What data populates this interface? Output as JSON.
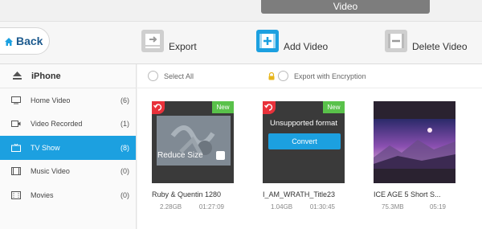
{
  "window": {
    "tab": "Video"
  },
  "toolbar": {
    "back_label": "Back",
    "export_label": "Export",
    "add_label": "Add Video",
    "delete_label": "Delete Video"
  },
  "sidebar": {
    "device": "iPhone",
    "items": [
      {
        "label": "Home Video",
        "count": "(6)",
        "icon": "tv-icon"
      },
      {
        "label": "Video Recorded",
        "count": "(1)",
        "icon": "camera-icon"
      },
      {
        "label": "TV Show",
        "count": "(8)",
        "icon": "tv-show-icon"
      },
      {
        "label": "Music Video",
        "count": "(0)",
        "icon": "film-icon"
      },
      {
        "label": "Movies",
        "count": "(0)",
        "icon": "movie-icon"
      }
    ]
  },
  "content": {
    "select_all": "Select All",
    "export_encryption": "Export with Encryption",
    "videos": [
      {
        "title": "Ruby & Quentin 1280",
        "size": "2.28GB",
        "duration": "01:27:09",
        "badge": "New",
        "overlay": "Reduce Size"
      },
      {
        "title": "I_AM_WRATH_Title23",
        "size": "1.04GB",
        "duration": "01:30:45",
        "badge": "New",
        "overlay": "Unsupported format",
        "button": "Convert"
      },
      {
        "title": "ICE AGE 5  Short    S...",
        "size": "75.3MB",
        "duration": "05:19"
      }
    ]
  },
  "colors": {
    "accent": "#1ca0e0",
    "new_badge": "#59c14a",
    "undo": "#e8313a",
    "brand_blue": "#1c5a8e"
  }
}
